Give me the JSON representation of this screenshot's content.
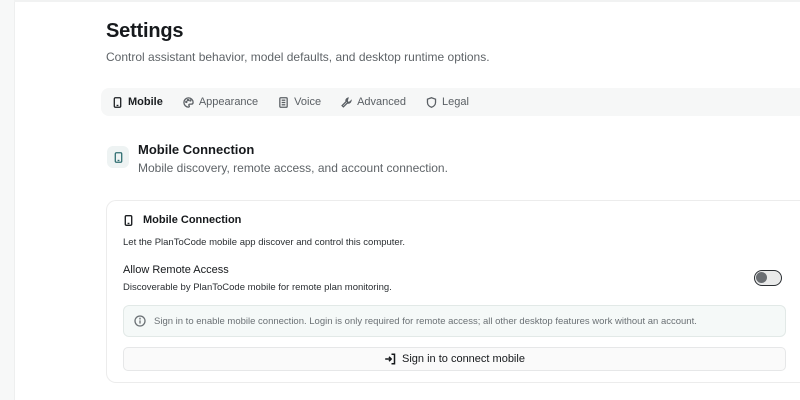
{
  "header": {
    "title": "Settings",
    "subtitle": "Control assistant behavior, model defaults, and desktop runtime options."
  },
  "tabs": [
    {
      "label": "Mobile",
      "icon": "smartphone-icon",
      "active": true
    },
    {
      "label": "Appearance",
      "icon": "palette-icon",
      "active": false
    },
    {
      "label": "Voice",
      "icon": "document-icon",
      "active": false
    },
    {
      "label": "Advanced",
      "icon": "wrench-icon",
      "active": false
    },
    {
      "label": "Legal",
      "icon": "shield-icon",
      "active": false
    }
  ],
  "section": {
    "icon": "smartphone-icon",
    "title": "Mobile Connection",
    "subtitle": "Mobile discovery, remote access, and account connection."
  },
  "card": {
    "icon": "smartphone-icon",
    "title": "Mobile Connection",
    "description": "Let the PlanToCode mobile app discover and control this computer.",
    "setting": {
      "label": "Allow Remote Access",
      "description": "Discoverable by PlanToCode mobile for remote plan monitoring.",
      "enabled": false
    },
    "notice": {
      "icon": "info-icon",
      "text": "Sign in to enable mobile connection. Login is only required for remote access; all other desktop features work without an account."
    },
    "signin_button": {
      "icon": "sign-in-icon",
      "label": "Sign in to connect mobile"
    }
  },
  "colors": {
    "accent": "#2e6d70",
    "notice_bg": "#f5f9f8",
    "toggle_border": "#2b2f33"
  }
}
